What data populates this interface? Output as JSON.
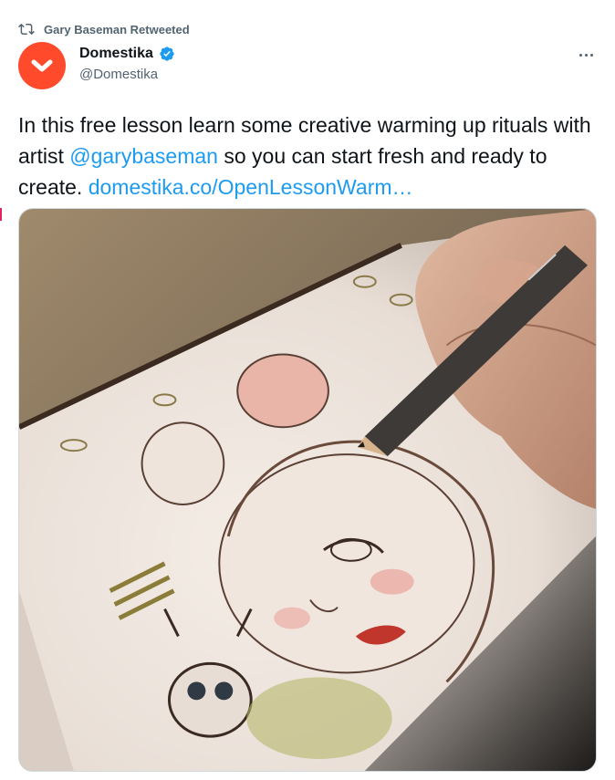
{
  "retweet": {
    "icon": "retweet-icon",
    "label": "Gary Baseman Retweeted"
  },
  "author": {
    "name": "Domestika",
    "handle": "@Domestika",
    "verified": true,
    "avatar_color": "#ff4a2b"
  },
  "tweet": {
    "text_part1": "In this free lesson learn some creative warming up rituals with artist ",
    "mention": "@garybaseman",
    "text_part2": " so you can start fresh and ready to create. ",
    "link": "domestika.co/OpenLessonWarm…"
  },
  "colors": {
    "link": "#1d9bf0",
    "secondary_text": "#536471",
    "text": "#0f1419"
  },
  "media": {
    "icon": "sketchbook-drawing-image"
  }
}
